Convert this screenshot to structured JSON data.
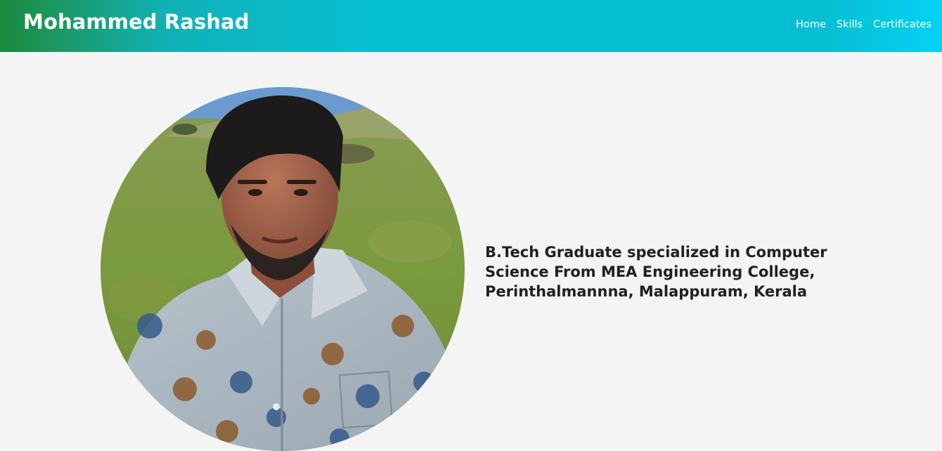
{
  "navbar": {
    "brand": "Mohammed Rashad",
    "links": [
      "Home",
      "Skills",
      "Certificates"
    ]
  },
  "hero": {
    "bio": "B.Tech Graduate specialized in Computer Science From MEA Engineering College, Perinthalmannna, Malappuram, Kerala",
    "photo_icon": "profile-photo"
  },
  "colors": {
    "navbar_start": "#1a8a3c",
    "navbar_mid": "#07bfd2",
    "navbar_end": "#05d2f7",
    "page_background": "#f4f4f4",
    "text": "#212121"
  }
}
